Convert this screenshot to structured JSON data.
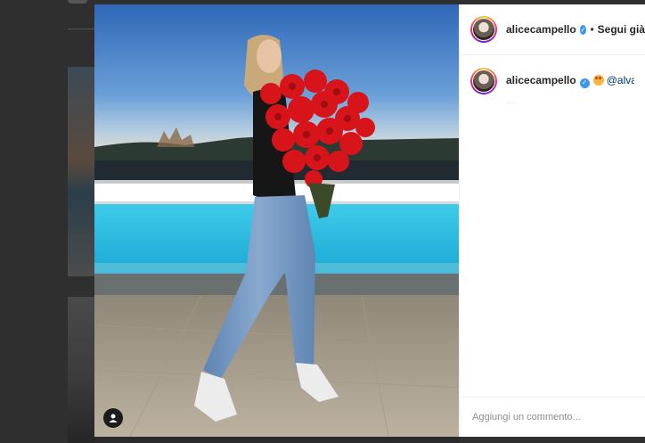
{
  "post": {
    "username": "alicecampello",
    "follow_separator": "•",
    "follow_state": "Segui già"
  },
  "caption": {
    "username": "alicecampello",
    "mention": "@alvarom",
    "loading_dots": "..."
  },
  "comment_input": {
    "placeholder": "Aggiungi un commento..."
  },
  "icons": [
    "verified-badge-icon",
    "user-tag-icon",
    "emoji-icon"
  ],
  "colors": {
    "accent": "#3897f0",
    "text": "#262626",
    "muted": "#8e8e8e",
    "mention": "#00376b"
  }
}
